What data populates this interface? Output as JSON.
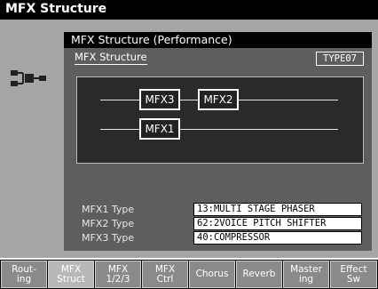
{
  "window": {
    "title": "MFX Structure"
  },
  "panel": {
    "header": "MFX Structure (Performance)",
    "structure_label": "MFX Structure",
    "structure_value": "TYPE07"
  },
  "diagram": {
    "boxes": {
      "mfx3": "MFX3",
      "mfx2": "MFX2",
      "mfx1": "MFX1"
    }
  },
  "types": [
    {
      "label": "MFX1 Type",
      "value": "13:MULTI STAGE PHASER"
    },
    {
      "label": "MFX2 Type",
      "value": "62:2VOICE PITCH SHIFTER"
    },
    {
      "label": "MFX3 Type",
      "value": "40:COMPRESSOR"
    }
  ],
  "tabs": [
    {
      "label": "Rout-\ning",
      "active": false
    },
    {
      "label": "MFX\nStruct",
      "active": true
    },
    {
      "label": "MFX\n1/2/3",
      "active": false
    },
    {
      "label": "MFX\nCtrl",
      "active": false
    },
    {
      "label": "Chorus",
      "active": false
    },
    {
      "label": "Reverb",
      "active": false
    },
    {
      "label": "Master\ning",
      "active": false
    },
    {
      "label": "Effect\nSw",
      "active": false
    }
  ],
  "icon": "routing-structure-icon"
}
